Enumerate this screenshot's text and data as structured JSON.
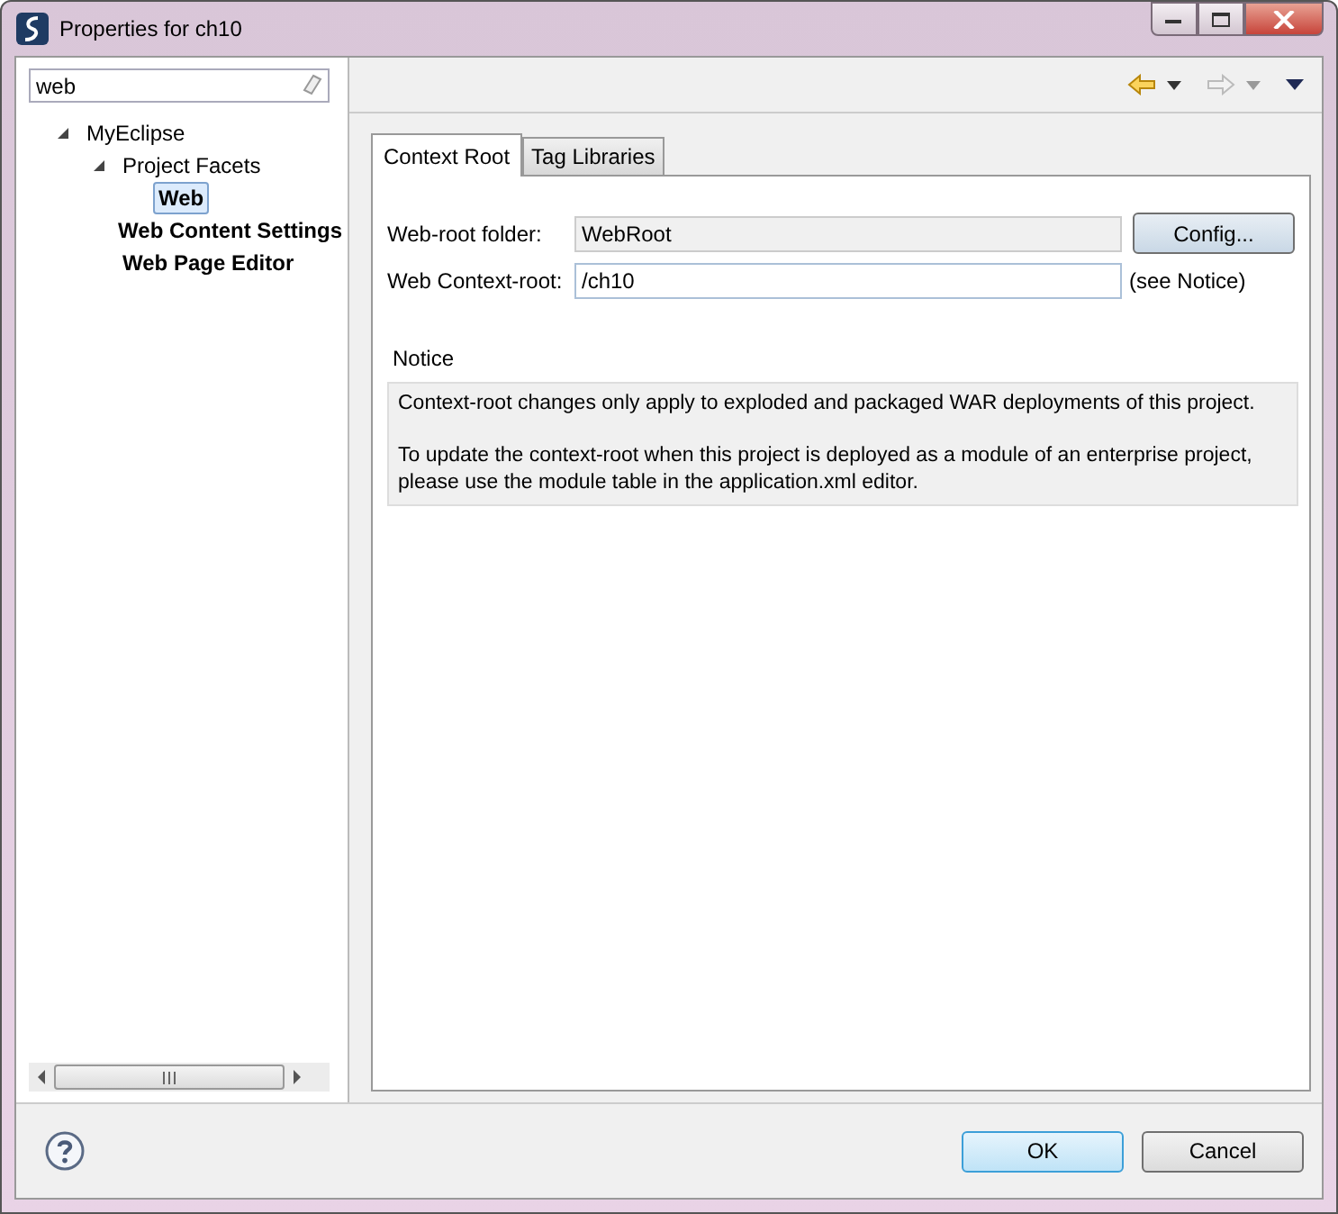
{
  "window": {
    "title": "Properties for ch10"
  },
  "filter": {
    "value": "web"
  },
  "tree": [
    {
      "label": "MyEclipse",
      "expanded": true,
      "match": false,
      "selected": false,
      "children": [
        {
          "label": "Project Facets",
          "expanded": true,
          "match": false,
          "selected": false,
          "children": [
            {
              "label": "Web",
              "match": true,
              "selected": true
            }
          ]
        },
        {
          "label": "Web Content Settings",
          "match": true,
          "selected": false
        },
        {
          "label": "Web Page Editor",
          "match": true,
          "selected": false
        }
      ]
    }
  ],
  "tabs": [
    {
      "label": "Context Root",
      "selected": true
    },
    {
      "label": "Tag Libraries",
      "selected": false
    }
  ],
  "form": {
    "webroot_label": "Web-root folder:",
    "webroot_value": "WebRoot",
    "config_button": "Config...",
    "context_label": "Web Context-root:",
    "context_value": "/ch10",
    "context_hint": "(see Notice)"
  },
  "notice": {
    "title": "Notice",
    "paragraphs": [
      "Context-root changes only apply to exploded and packaged WAR deployments of this project.",
      "To update the context-root when this project is deployed as a module of an enterprise project, please use the module table in the application.xml editor."
    ]
  },
  "buttons": [
    {
      "label": "OK",
      "default": true
    },
    {
      "label": "Cancel",
      "default": false
    }
  ]
}
